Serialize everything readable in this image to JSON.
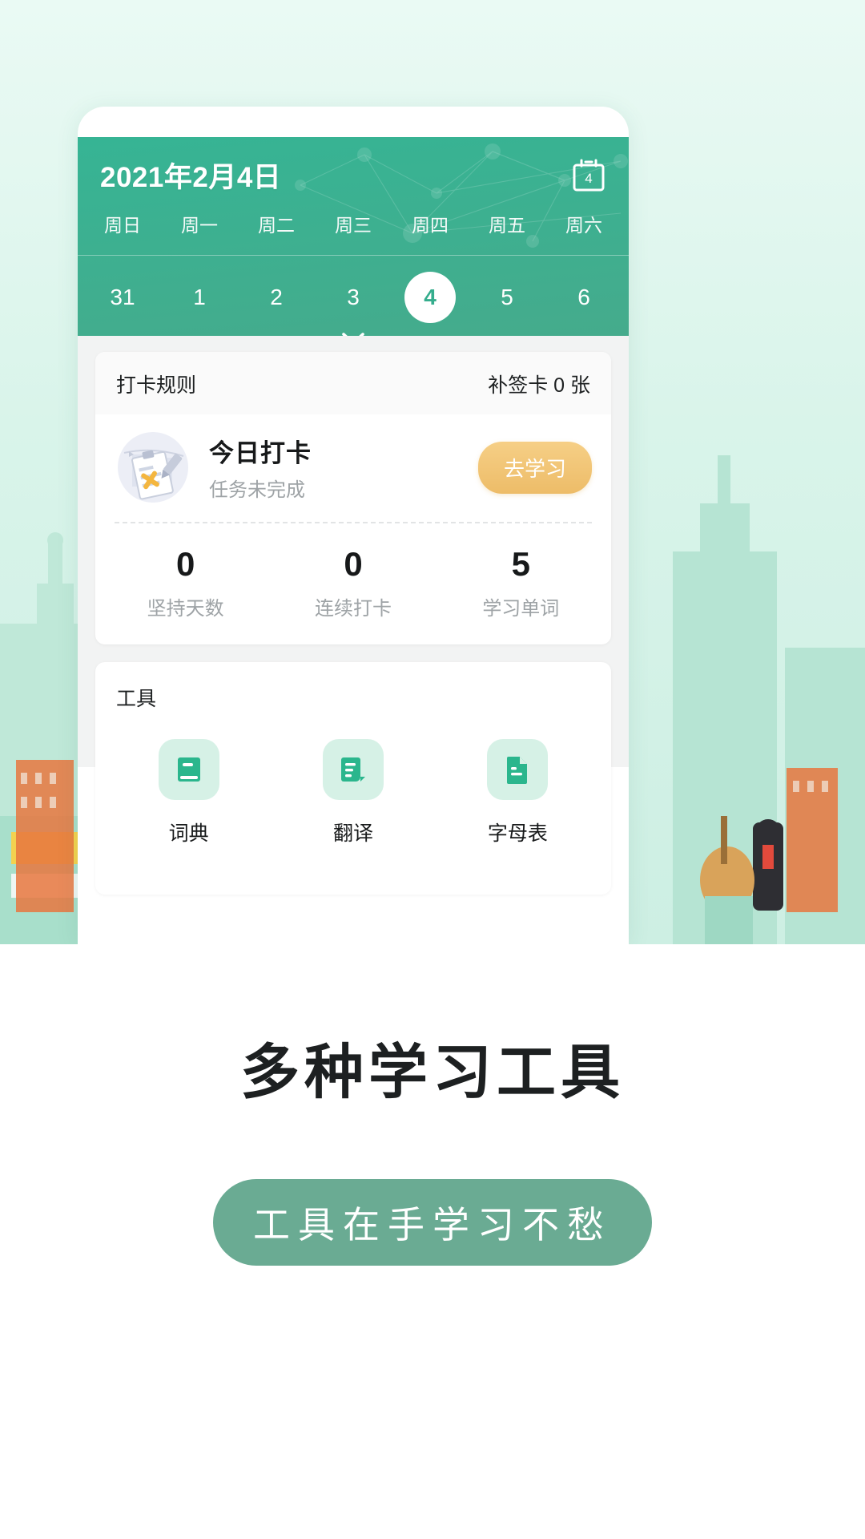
{
  "header": {
    "date_title": "2021年2月4日",
    "calendar_icon_day": "4",
    "calendar_icon": "calendar-day-icon",
    "expand_icon": "chevron-down-icon",
    "weekdays": [
      "周日",
      "周一",
      "周二",
      "周三",
      "周四",
      "周五",
      "周六"
    ],
    "days": [
      {
        "num": "31",
        "active": false
      },
      {
        "num": "1",
        "active": false
      },
      {
        "num": "2",
        "active": false
      },
      {
        "num": "3",
        "active": false
      },
      {
        "num": "4",
        "active": true
      },
      {
        "num": "5",
        "active": false
      },
      {
        "num": "6",
        "active": false
      }
    ],
    "accent_green": "#36b494"
  },
  "checkin_card": {
    "rules_label": "打卡规则",
    "makeup_cards": "补签卡 0 张",
    "today_title": "今日打卡",
    "today_status": "任务未完成",
    "action_button": "去学习",
    "action_button_color": "#eebc68",
    "illustration_icon": "clipboard-cross-icon",
    "stats": [
      {
        "value": "0",
        "label": "坚持天数"
      },
      {
        "value": "0",
        "label": "连续打卡"
      },
      {
        "value": "5",
        "label": "学习单词"
      }
    ]
  },
  "tools_card": {
    "title": "工具",
    "items": [
      {
        "label": "词典",
        "icon": "book-icon"
      },
      {
        "label": "翻译",
        "icon": "document-lines-icon"
      },
      {
        "label": "字母表",
        "icon": "file-text-icon"
      }
    ],
    "icon_color": "#2bb68d",
    "icon_bg": "#d6f1e6"
  },
  "promo": {
    "headline": "多种学习工具",
    "pill_text": "工具在手学习不愁",
    "pill_color": "#6aab93"
  }
}
